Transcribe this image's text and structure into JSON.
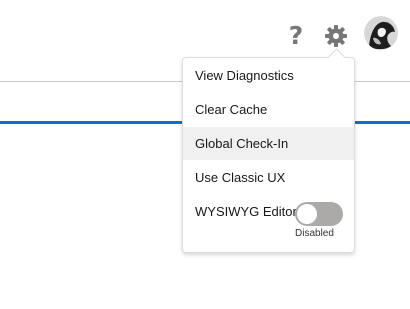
{
  "header": {
    "help_icon": "question-mark-icon",
    "settings_icon": "gear-icon",
    "avatar_icon": "user-avatar"
  },
  "setup_menu": {
    "items": [
      {
        "label": "View Diagnostics"
      },
      {
        "label": "Clear Cache"
      },
      {
        "label": "Global Check-In",
        "highlighted": true
      },
      {
        "label": "Use Classic UX"
      }
    ],
    "wysiwyg": {
      "label": "WYSIWYG Editor",
      "enabled": false,
      "status": "Disabled"
    }
  },
  "colors": {
    "accent_bar": "#0a70d4",
    "toggle_off": "#acaaa8",
    "icon_gray": "#777777",
    "hover_bg": "#f0f0f0"
  }
}
